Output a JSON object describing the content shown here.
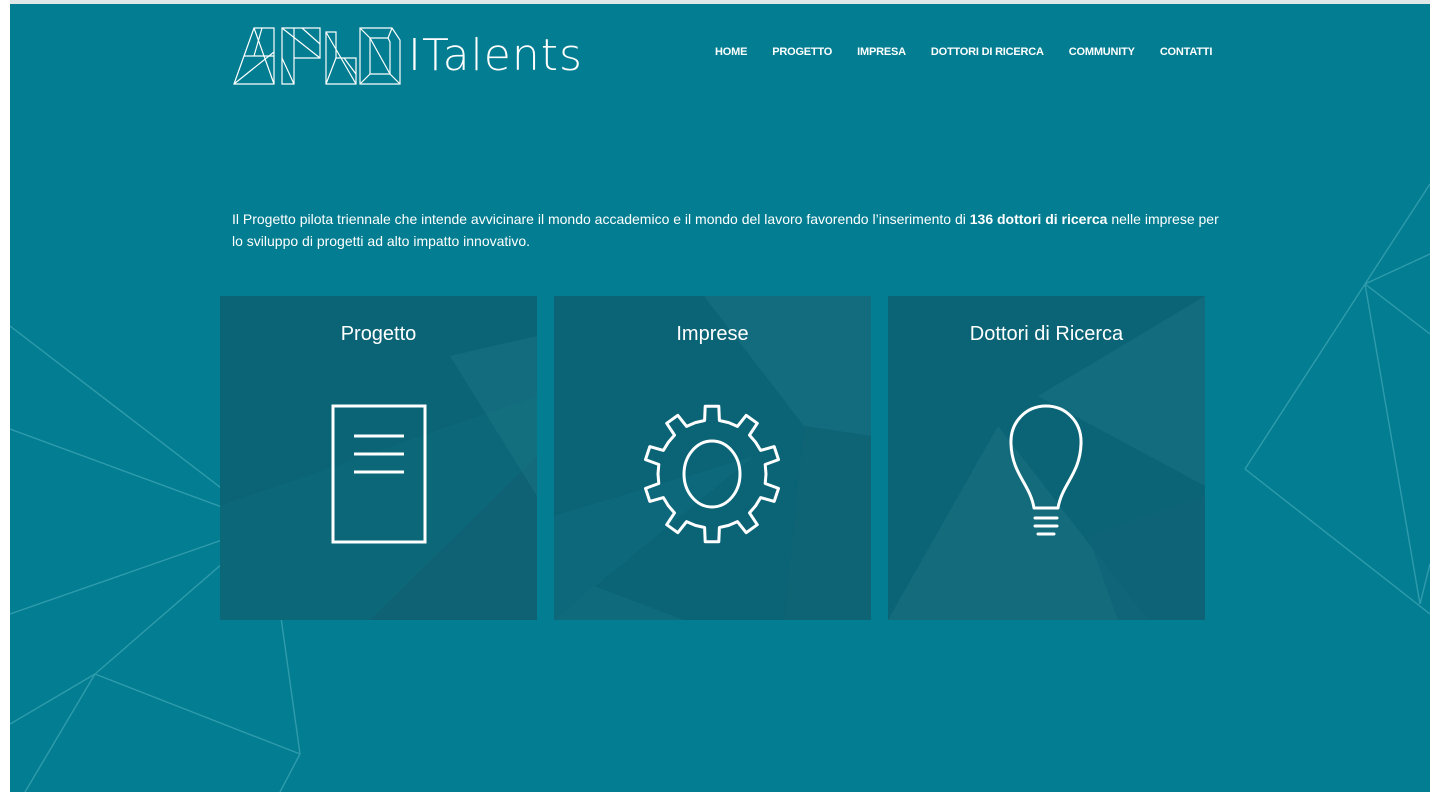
{
  "brand": {
    "name": "ITalents",
    "monogram_icon": "phd-polygon-logo-icon"
  },
  "nav": {
    "items": [
      "HOME",
      "PROGETTO",
      "IMPRESA",
      "DOTTORI DI RICERCA",
      "COMMUNITY",
      "CONTATTI"
    ]
  },
  "intro": {
    "before": "Il Progetto pilota triennale che intende avvicinare il mondo accademico e il mondo del lavoro favorendo l’inserimento di ",
    "highlight": "136 dottori di ricerca",
    "after": " nelle imprese per lo sviluppo di progetti ad alto impatto innovativo."
  },
  "cards": [
    {
      "title": "Progetto",
      "icon": "document-icon"
    },
    {
      "title": "Imprese",
      "icon": "gear-icon"
    },
    {
      "title": "Dottori di Ricerca",
      "icon": "lightbulb-icon"
    }
  ],
  "colors": {
    "background": "#027d91",
    "card": "#0a6476",
    "text": "#ffffff"
  }
}
